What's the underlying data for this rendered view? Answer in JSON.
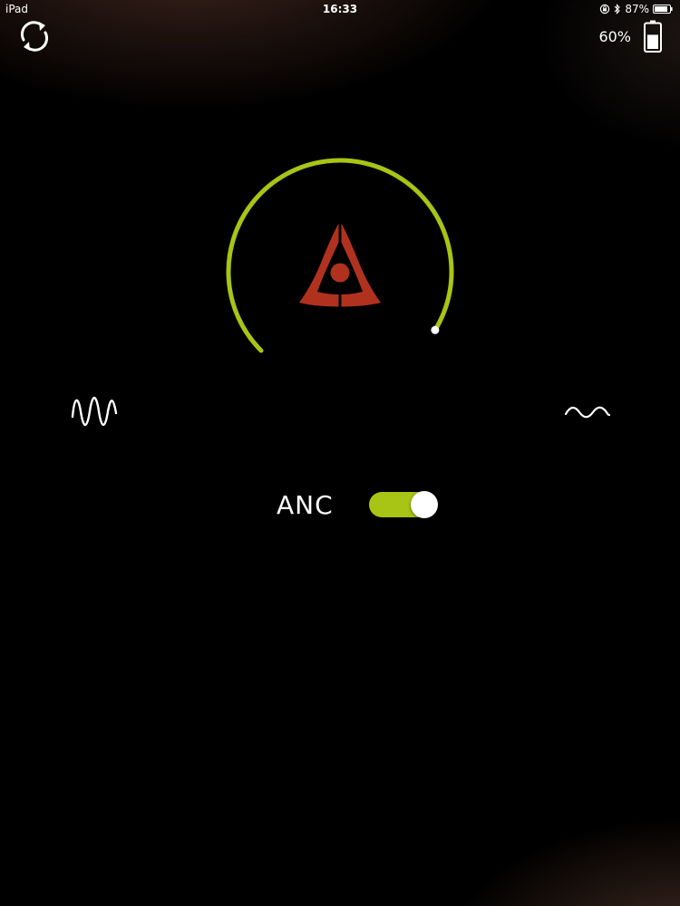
{
  "status_bar": {
    "device": "iPad",
    "time": "16:33",
    "battery_percent": "87%",
    "icons": [
      "orientation-lock-icon",
      "bluetooth-icon",
      "battery-icon"
    ]
  },
  "header": {
    "sync_icon": "sync-icon",
    "headset_battery_text": "60%",
    "headset_battery_level": 0.6
  },
  "dial": {
    "icon": "brand-logo-icon",
    "level": 0.95,
    "track_color": "#a8c414",
    "logo_color": "#b0321e"
  },
  "modes": {
    "left_icon": "strong-wave-icon",
    "right_icon": "soft-wave-icon"
  },
  "anc": {
    "label": "ANC",
    "enabled": true,
    "accent_color": "#a8c414"
  }
}
